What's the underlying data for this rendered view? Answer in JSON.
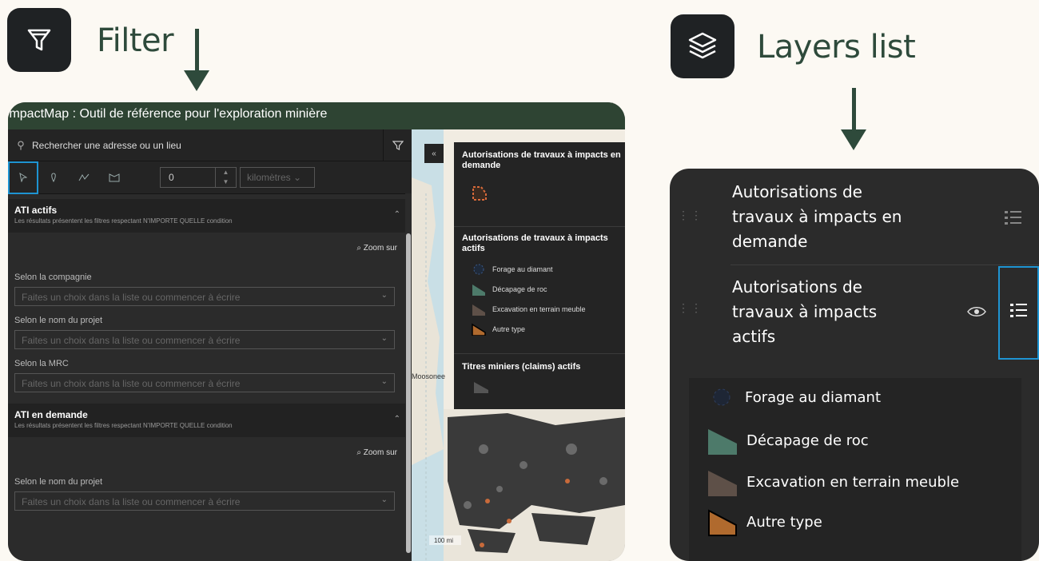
{
  "filter_header": {
    "title": "Filter",
    "icon": "funnel-icon"
  },
  "layers_header": {
    "title": "Layers list",
    "icon": "layers-icon"
  },
  "app": {
    "title": "ImpactMap : Outil de référence pour l'exploration minière",
    "search_placeholder": "Rechercher une adresse ou un lieu",
    "distance_value": "0",
    "distance_unit": "kilomètres",
    "sections": [
      {
        "title": "ATI actifs",
        "subtitle": "Les résultats présentent les filtres respectant N'IMPORTE QUELLE condition",
        "zoom_label": "Zoom sur",
        "fields": [
          {
            "label": "Selon la compagnie",
            "placeholder": "Faites un choix dans la liste ou commencer à écrire"
          },
          {
            "label": "Selon le nom du projet",
            "placeholder": "Faites un choix dans la liste ou commencer à écrire"
          },
          {
            "label": "Selon la MRC",
            "placeholder": "Faites un choix dans la liste ou commencer à écrire"
          }
        ]
      },
      {
        "title": "ATI en demande",
        "subtitle": "Les résultats présentent les filtres respectant N'IMPORTE QUELLE condition",
        "zoom_label": "Zoom sur",
        "fields": [
          {
            "label": "Selon le nom du projet",
            "placeholder": "Faites un choix dans la liste ou commencer à écrire"
          }
        ]
      }
    ],
    "legend": {
      "group1": "Autorisations de travaux à impacts en demande",
      "group2": "Autorisations de travaux à impacts actifs",
      "items": [
        "Forage au diamant",
        "Décapage de roc",
        "Excavation en terrain meuble",
        "Autre type"
      ],
      "group3": "Titres miniers (claims) actifs"
    },
    "map_labels": {
      "place": "Moosonee",
      "scale": "100 mi"
    }
  },
  "layers": {
    "layer1": "Autorisations de travaux à impacts en demande",
    "layer2": "Autorisations de travaux à impacts actifs",
    "items": [
      "Forage au diamant",
      "Décapage de roc",
      "Excavation en terrain meuble",
      "Autre type"
    ]
  },
  "colors": {
    "accent_green": "#2e4a3b",
    "selection_blue": "#1e94d2",
    "decapage": "#4d7a6a",
    "excavation": "#5e5048",
    "autre": "#b06a2e"
  }
}
